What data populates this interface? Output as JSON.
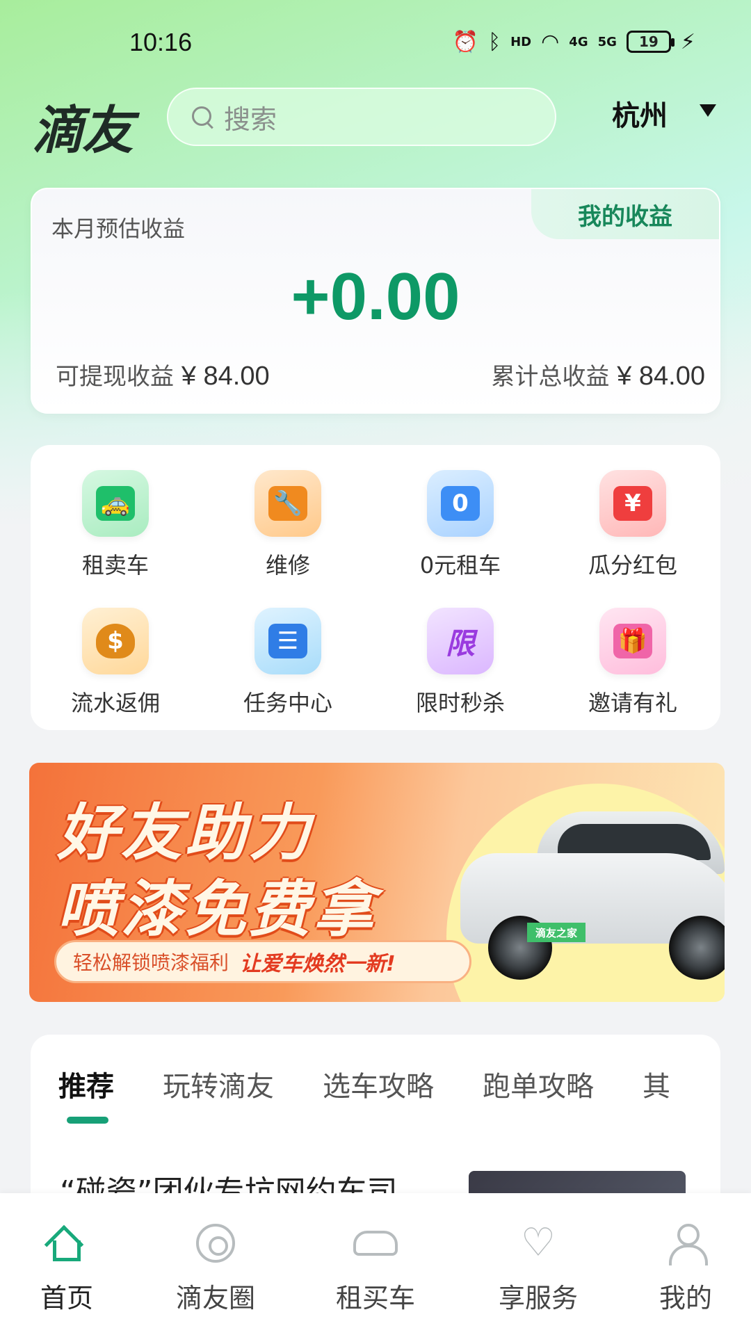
{
  "status_bar": {
    "time": "10:16",
    "icons": [
      "alarm-icon",
      "bluetooth-icon",
      "hd-icon",
      "wifi-icon",
      "4g-signal-icon",
      "5g-signal-icon",
      "battery-icon",
      "charging-icon"
    ],
    "hd_label": "HD",
    "signal_4g": "4G",
    "signal_5g": "5G",
    "battery_level": "19"
  },
  "header": {
    "logo": "滴友",
    "search_placeholder": "搜索",
    "city": "杭州"
  },
  "earnings": {
    "tab_label": "我的收益",
    "month_label": "本月预估收益",
    "month_amount": "+0.00",
    "withdrawable_label": "可提现收益",
    "withdrawable_value": "¥ 84.00",
    "total_label": "累计总收益",
    "total_value": "¥ 84.00"
  },
  "features": [
    {
      "label": "租卖车",
      "icon": "taxi-icon",
      "glyph": "🚕"
    },
    {
      "label": "维修",
      "icon": "repair-icon",
      "glyph": "🔧"
    },
    {
      "label": "0元租车",
      "icon": "zero-rent-icon",
      "glyph": "0"
    },
    {
      "label": "瓜分红包",
      "icon": "red-envelope-icon",
      "glyph": "¥"
    },
    {
      "label": "流水返佣",
      "icon": "money-bag-icon",
      "glyph": "$"
    },
    {
      "label": "任务中心",
      "icon": "task-list-icon",
      "glyph": "☰"
    },
    {
      "label": "限时秒杀",
      "icon": "flash-sale-icon",
      "glyph": "限"
    },
    {
      "label": "邀请有礼",
      "icon": "gift-icon",
      "glyph": "🎁"
    }
  ],
  "banner": {
    "title_line1": "好友助力",
    "title_line2": "喷漆免费拿",
    "subtitle_a": "轻松解锁喷漆福利",
    "subtitle_b": "让爱车焕然一新!",
    "plate_text": "滴友之家"
  },
  "news": {
    "tabs": [
      "推荐",
      "玩转滴友",
      "选车攻略",
      "跑单攻略",
      "其"
    ],
    "active_tab": "推荐",
    "first_title": "“碰瓷”团伙专坑网约车司"
  },
  "bottom_nav": [
    {
      "label": "首页",
      "icon": "home-icon",
      "active": true
    },
    {
      "label": "滴友圈",
      "icon": "community-icon",
      "active": false
    },
    {
      "label": "租买车",
      "icon": "car-icon",
      "active": false
    },
    {
      "label": "享服务",
      "icon": "heart-icon",
      "active": false
    },
    {
      "label": "我的",
      "icon": "user-icon",
      "active": false
    }
  ],
  "colors": {
    "brand_green": "#0e9966",
    "tab_indicator": "#17a077",
    "banner_orange": "#f4723a"
  }
}
